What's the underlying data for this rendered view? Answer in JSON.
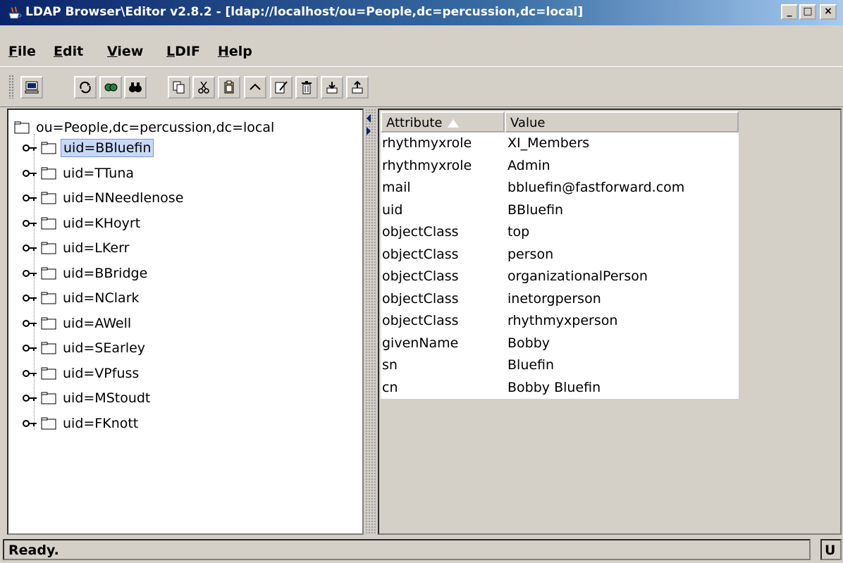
{
  "title": "LDAP Browser\\Editor v2.8.2 - [ldap://localhost/ou=People,dc=percussion,dc=local]",
  "window_controls": {
    "min": "_",
    "max": "□",
    "close": "×"
  },
  "menu": [
    {
      "label": "File",
      "u": "F",
      "rest": "ile"
    },
    {
      "label": "Edit",
      "u": "E",
      "rest": "dit"
    },
    {
      "label": "View",
      "u": "V",
      "rest": "iew"
    },
    {
      "label": "LDIF",
      "u": "L",
      "rest": "DIF"
    },
    {
      "label": "Help",
      "u": "H",
      "rest": "elp"
    }
  ],
  "toolbar": [
    "connect-icon",
    "refresh-icon",
    "search-icon",
    "find-icon",
    "copy-icon",
    "cut-icon",
    "paste-icon",
    "up-icon",
    "edit-icon",
    "delete-icon",
    "export-icon",
    "import-icon"
  ],
  "tree": {
    "root": "ou=People,dc=percussion,dc=local",
    "nodes": [
      "uid=BBluefin",
      "uid=TTuna",
      "uid=NNeedlenose",
      "uid=KHoyrt",
      "uid=LKerr",
      "uid=BBridge",
      "uid=NClark",
      "uid=AWell",
      "uid=SEarley",
      "uid=VPfuss",
      "uid=MStoudt",
      "uid=FKnott"
    ],
    "selected": "uid=BBluefin"
  },
  "table": {
    "headers": [
      "Attribute",
      "Value"
    ],
    "rows": [
      [
        "rhythmyxrole",
        "XI_Members"
      ],
      [
        "rhythmyxrole",
        "Admin"
      ],
      [
        "mail",
        "bbluefin@fastforward.com"
      ],
      [
        "uid",
        "BBluefin"
      ],
      [
        "objectClass",
        "top"
      ],
      [
        "objectClass",
        "person"
      ],
      [
        "objectClass",
        "organizationalPerson"
      ],
      [
        "objectClass",
        "inetorgperson"
      ],
      [
        "objectClass",
        "rhythmyxperson"
      ],
      [
        "givenName",
        "Bobby"
      ],
      [
        "sn",
        "Bluefin"
      ],
      [
        "cn",
        "Bobby Bluefin"
      ]
    ]
  },
  "status": {
    "text": "Ready.",
    "right": "U"
  },
  "colors": {
    "title_start": "#0a246a",
    "title_end": "#a6caf0",
    "face": "#d4d0c8",
    "selection": "#c8d8f8"
  }
}
